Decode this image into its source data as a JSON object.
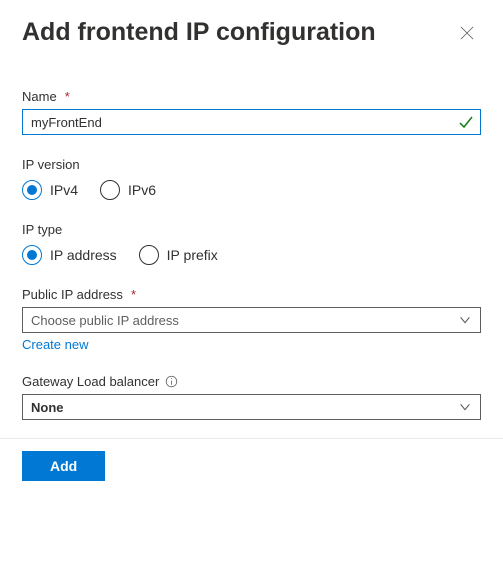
{
  "header": {
    "title": "Add frontend IP configuration"
  },
  "fields": {
    "name": {
      "label": "Name",
      "value": "myFrontEnd",
      "required": true
    },
    "ip_version": {
      "label": "IP version",
      "options": [
        "IPv4",
        "IPv6"
      ],
      "selected": "IPv4"
    },
    "ip_type": {
      "label": "IP type",
      "options": [
        "IP address",
        "IP prefix"
      ],
      "selected": "IP address"
    },
    "public_ip": {
      "label": "Public IP address",
      "required": true,
      "placeholder": "Choose public IP address",
      "create_link": "Create new"
    },
    "gateway_lb": {
      "label": "Gateway Load balancer",
      "value": "None"
    }
  },
  "footer": {
    "submit": "Add"
  },
  "req_mark": "*"
}
